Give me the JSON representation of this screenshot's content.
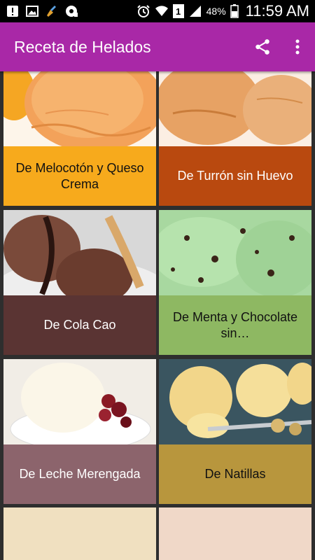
{
  "status_bar": {
    "battery_percent": "48%",
    "time": "11:59 AM",
    "sim_slot": "1",
    "icons": [
      "notification-alert-icon",
      "image-icon",
      "broom-icon",
      "media-icon",
      "alarm-icon",
      "wifi-icon",
      "sim-icon",
      "signal-icon",
      "battery-icon"
    ]
  },
  "app_bar": {
    "title": "Receta de Helados",
    "actions": [
      "share-icon",
      "overflow-menu-icon"
    ]
  },
  "recipes": [
    {
      "label": "De Melocotón y Queso Crema",
      "color": "#f7aa1c",
      "text_color": "dark"
    },
    {
      "label": "De Turrón sin Huevo",
      "color": "#b9490f",
      "text_color": "light"
    },
    {
      "label": "De Cola Cao",
      "color": "#5a3433",
      "text_color": "light"
    },
    {
      "label": "De Menta y Chocolate sin…",
      "color": "#8eb862",
      "text_color": "dark"
    },
    {
      "label": "De Leche Merengada",
      "color": "#8c646c",
      "text_color": "light"
    },
    {
      "label": "De Natillas",
      "color": "#b8963d",
      "text_color": "dark"
    }
  ],
  "colors": {
    "app_bar": "#a928a7",
    "background": "#2e2e2e",
    "status_bar": "#000000"
  }
}
